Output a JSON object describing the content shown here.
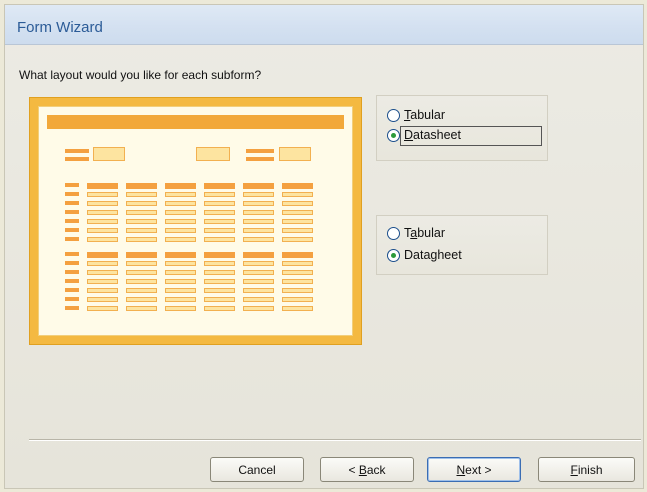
{
  "window": {
    "title": "Form Wizard"
  },
  "question": "What layout would you like for each subform?",
  "groups": [
    {
      "options": [
        {
          "pre": "",
          "key": "T",
          "post": "abular",
          "selected": false
        },
        {
          "pre": "",
          "key": "D",
          "post": "atasheet",
          "selected": true
        }
      ]
    },
    {
      "options": [
        {
          "pre": "T",
          "key": "a",
          "post": "bular",
          "selected": false
        },
        {
          "pre": "Data",
          "key": "g",
          "post": "heet",
          "selected": true
        }
      ]
    }
  ],
  "buttons": {
    "cancel": "Cancel",
    "back_pre": "< ",
    "back_key": "B",
    "back_post": "ack",
    "next_key": "N",
    "next_post": "ext >",
    "finish_key": "F",
    "finish_post": "inish"
  },
  "colors": {
    "title": "#2b5b97",
    "preview_frame": "#f4b941",
    "preview_accent": "#f4a040",
    "radio_dot": "#2c9a3a"
  }
}
